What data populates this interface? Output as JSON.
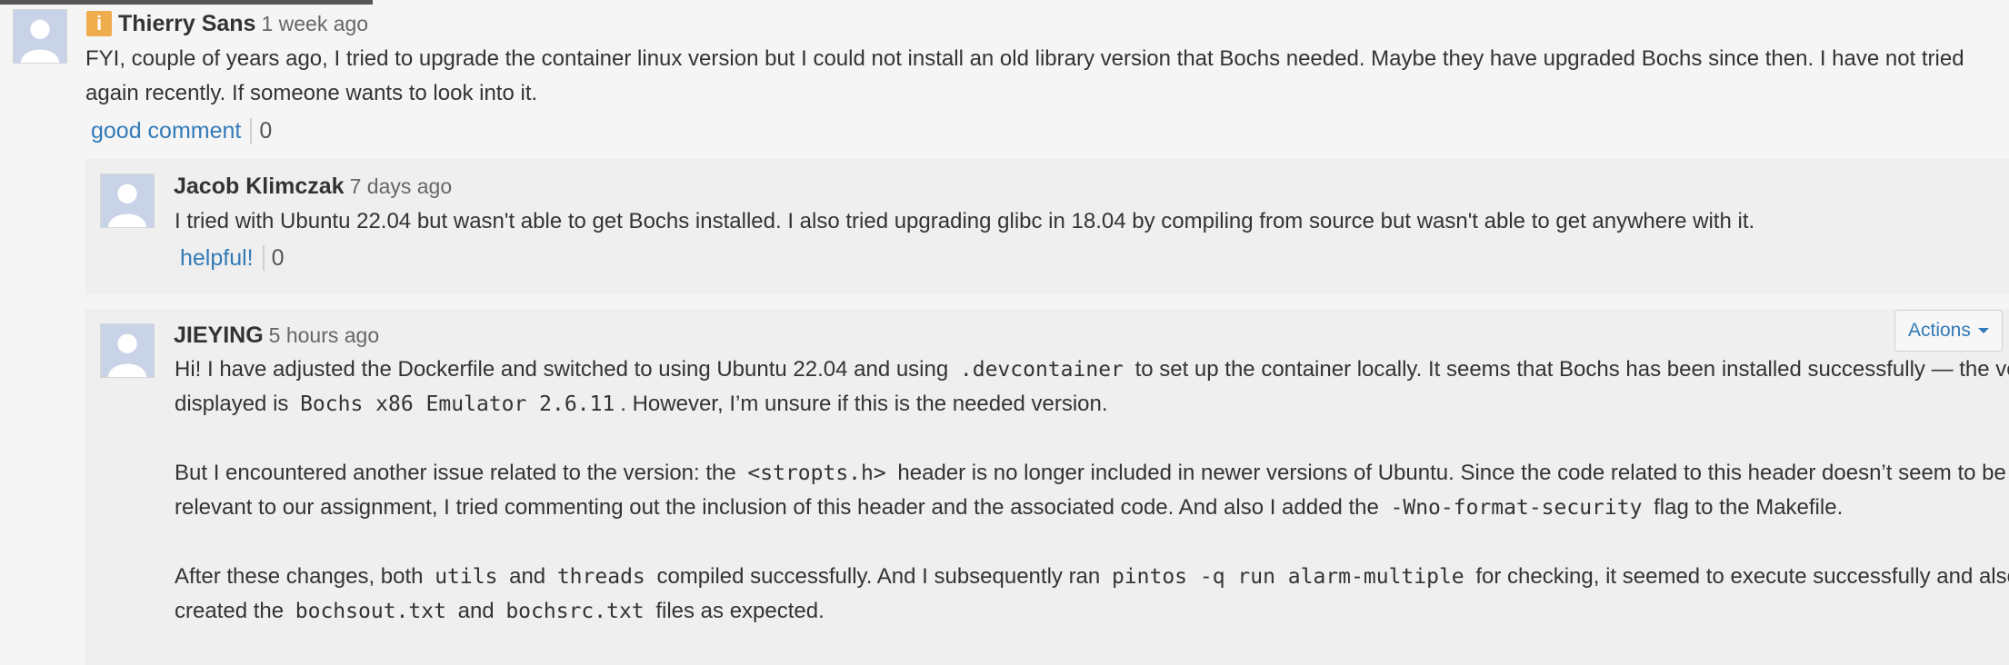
{
  "comments": [
    {
      "author": "Thierry Sans",
      "time": "1 week ago",
      "badge": "i",
      "body": "FYI, couple of years ago, I tried to upgrade the container linux version but I could not install an old library version that Bochs needed. Maybe they have upgraded Bochs since then. I have not tried again recently. If someone wants to look into it.",
      "vote_label": "good comment",
      "vote_count": "0"
    }
  ],
  "replies": [
    {
      "author": "Jacob Klimczak",
      "time": "7 days ago",
      "body": "I tried with Ubuntu 22.04 but wasn't able to get Bochs installed. I also tried upgrading glibc in 18.04 by compiling from source but wasn't able to get anywhere with it.",
      "vote_label": "helpful!",
      "vote_count": "0"
    },
    {
      "author": "JIEYING",
      "time": "5 hours ago",
      "actions_label": "Actions",
      "p1": {
        "t1": "Hi! I have adjusted the Dockerfile and switched to using Ubuntu 22.04 and using",
        "c1": ".devcontainer",
        "t2": "to set up the container locally. It seems that Bochs has been installed successfully — the version displayed is",
        "c2": "Bochs x86 Emulator 2.6.11",
        "t3": ". However, I’m unsure if this is the needed version."
      },
      "p2": {
        "t1": "But I encountered another issue related to the version: the",
        "c1": "<stropts.h>",
        "t2": "header is no longer included in newer versions of Ubuntu. Since the code related to this header doesn’t seem to be relevant to our assignment, I tried commenting out the inclusion of this header and the associated code. And also I added the",
        "c2": "-Wno-format-security",
        "t3": "flag to the Makefile."
      },
      "p3": {
        "t1": "After these changes, both",
        "c1": "utils",
        "t2": "and",
        "c2": "threads",
        "t3": "compiled successfully. And I subsequently ran",
        "c3": "pintos -q run alarm-multiple",
        "t4": "for checking, it seemed to execute successfully and also created the",
        "c4": "bochsout.txt",
        "t5": "and",
        "c5": "bochsrc.txt",
        "t6": "files as expected."
      }
    }
  ],
  "icons": {
    "avatar": "default-avatar-icon",
    "badge": "instructor-badge-icon",
    "caret": "chevron-down-icon"
  },
  "colors": {
    "link": "#337ab7",
    "badge": "#f0ad4e",
    "reply_bg": "#efefef",
    "page_bg": "#f5f5f5"
  }
}
